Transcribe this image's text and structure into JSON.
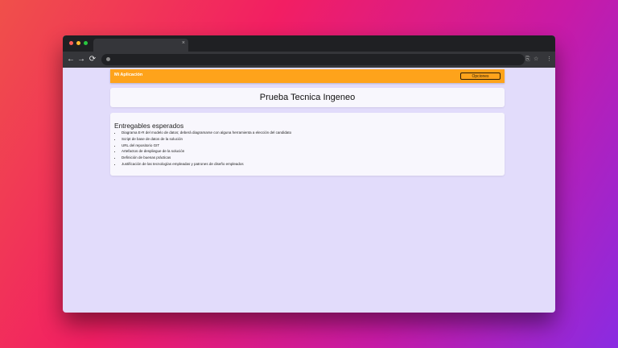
{
  "browser": {
    "tab_close": "×",
    "back_glyph": "←",
    "forward_glyph": "→",
    "reload_glyph": "⟳",
    "omnibox_right_icons": [
      "⎘",
      "☆",
      "⋮"
    ]
  },
  "navbar": {
    "brand": "Mi Aplicación",
    "options_button": "Opciones",
    "color": "#fea31b"
  },
  "main": {
    "title": "Prueba Tecnica Ingeneo",
    "section_title": "Entregables esperados",
    "items": [
      "Diagrama E-R del modelo de datos; deberá diagramarse con alguna herramienta a elección del candidato",
      "Script de base de datos de la solución",
      "URL del repositorio GIT",
      "Artefactos de despliegue de la solución",
      "Definición de buenas prácticas",
      "Justificación de las tecnologías empleadas y patrones de diseño empleados"
    ]
  },
  "icons": {
    "window_controls": [
      "close-dot",
      "minimize-dot",
      "maximize-dot"
    ],
    "omnibox": "site-info-icon"
  }
}
